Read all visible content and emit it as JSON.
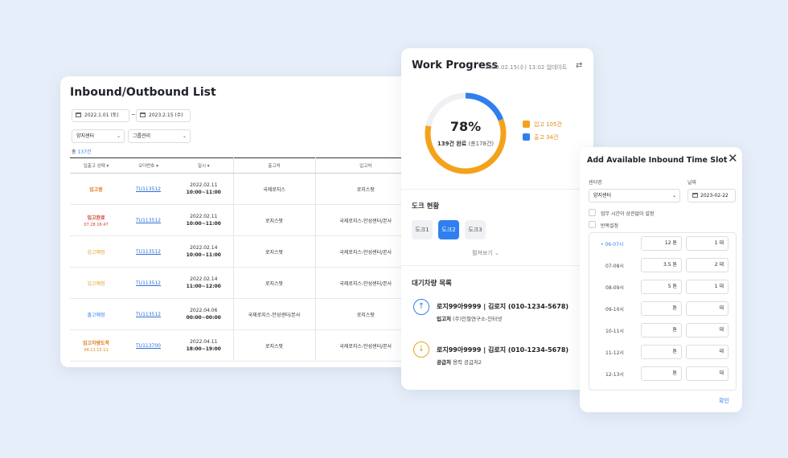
{
  "list": {
    "title": "Inbound/Outbound List",
    "date_from": "2022.1.01 (토)",
    "date_sep": "~",
    "date_to": "2023.2.15 (수)",
    "filter_center": "양지센터",
    "filter_group": "그룹관리",
    "total_prefix": "총",
    "total_count": "137건",
    "columns": [
      "입출고 상태 ▾",
      "오더번호 ▾",
      "일시 ▾",
      "출고처",
      "입고처"
    ],
    "rows": [
      {
        "status": "입고중",
        "sub": "",
        "order": "TU113512",
        "date": "2022.02.11",
        "time": "10:00~11:00",
        "from": "국제로지스",
        "to": "로지스팟"
      },
      {
        "status": "입고완료",
        "sub": "07.28 16:47",
        "order": "TU113512",
        "date": "2022.02.11",
        "time": "10:00~11:00",
        "from": "로지스팟",
        "to": "국제로지스-안성센터/본사"
      },
      {
        "status": "입고예정",
        "sub": "",
        "order": "TU113512",
        "date": "2022.02.14",
        "time": "10:00~11:00",
        "from": "로지스팟",
        "to": "국제로지스-안성센터/본사"
      },
      {
        "status": "입고예정",
        "sub": "",
        "order": "TU113512",
        "date": "2022.02.14",
        "time": "11:00~12:00",
        "from": "로지스팟",
        "to": "국제로지스-안성센터/본사"
      },
      {
        "status": "출고예정",
        "sub": "",
        "order": "TU113512",
        "date": "2022.04.06",
        "time": "00:00~00:00",
        "from": "국제로지스-안성센터/본사",
        "to": "로지스팟"
      },
      {
        "status": "입고차량도착",
        "sub": "04.11 15:11",
        "order": "TU113700",
        "date": "2022.04.11",
        "time": "18:00~19:00",
        "from": "로지스팟",
        "to": "국제로지스-안성센터/본사"
      }
    ]
  },
  "progress": {
    "title": "Work Progress",
    "updated": "2023.02.15(수) 13:02 업데이트",
    "refresh_icon": "refresh-icon",
    "percent_label": "78%",
    "percent": 78,
    "done_main": "139건 완료",
    "done_total": "(총178건)",
    "legend_in": "입고 105건",
    "legend_out": "출고 34건",
    "color_in": "#f5a21b",
    "color_out": "#2f7ff0",
    "dock_title": "도크 현황",
    "docks": [
      "도크1",
      "도크2",
      "도크3"
    ],
    "dock_active": 1,
    "more": "펼쳐보기",
    "waiting_title": "대기차량 목록",
    "vehicles": [
      {
        "plate": "로지99아9999",
        "driver": "| 김로지 (010-1234-5678)",
        "kind": "입고처",
        "place": "(주)인철연구소-인터넷"
      },
      {
        "plate": "로지99아9999",
        "driver": "| 김로지 (010-1234-5678)",
        "kind": "공급처",
        "place": "용력 공급처2"
      }
    ]
  },
  "slot": {
    "title": "Add Available Inbound Time Slot",
    "center_label": "센터명",
    "center_value": "양지센터",
    "date_label": "날짜",
    "date_value": "2023-02-22",
    "chk_overlap": "업무 시간이 상관없이 설정",
    "chk_repeat": "반복설정",
    "slots": [
      {
        "time": "06-07시",
        "ton": "12",
        "unit_ton": "톤",
        "count": "1",
        "unit_count": "대"
      },
      {
        "time": "07-08시",
        "ton": "3.5",
        "unit_ton": "톤",
        "count": "2",
        "unit_count": "대"
      },
      {
        "time": "08-09시",
        "ton": "5",
        "unit_ton": "톤",
        "count": "1",
        "unit_count": "대"
      },
      {
        "time": "09-10시",
        "ton": "",
        "unit_ton": "톤",
        "count": "",
        "unit_count": "대"
      },
      {
        "time": "10-11시",
        "ton": "",
        "unit_ton": "톤",
        "count": "",
        "unit_count": "대"
      },
      {
        "time": "11-12시",
        "ton": "",
        "unit_ton": "톤",
        "count": "",
        "unit_count": "대"
      },
      {
        "time": "12-13시",
        "ton": "",
        "unit_ton": "톤",
        "count": "",
        "unit_count": "대"
      }
    ],
    "confirm": "확인"
  }
}
